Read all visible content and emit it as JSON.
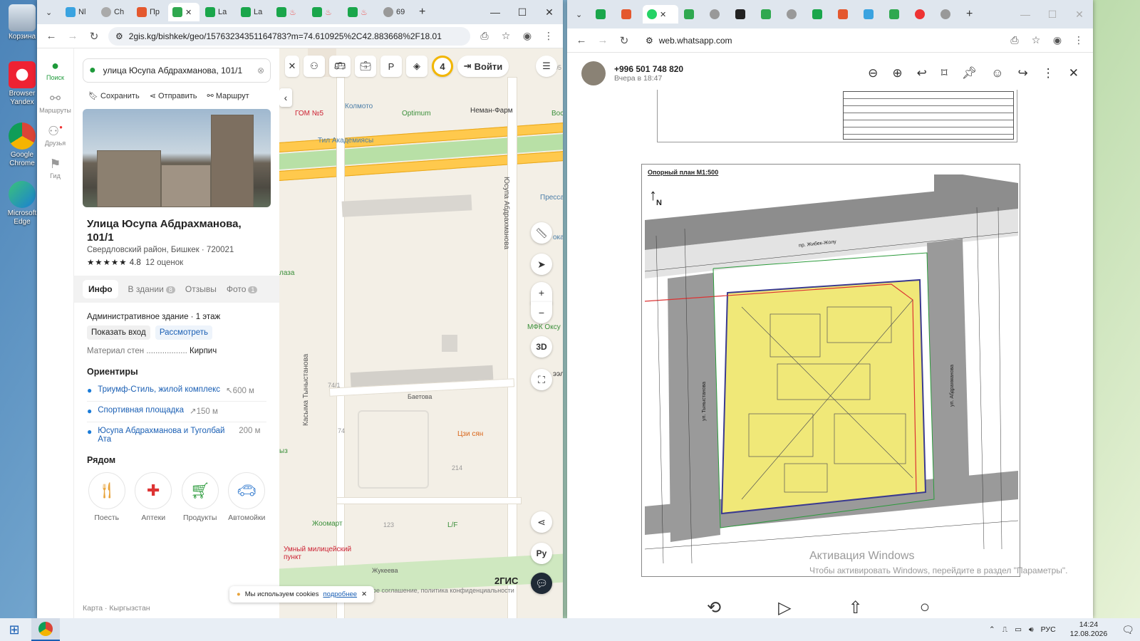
{
  "desktop": {
    "icons": [
      {
        "label": "Корзина"
      },
      {
        "label": "Browser Yandex"
      },
      {
        "label": "Google Chrome"
      },
      {
        "label": "Microsoft Edge"
      }
    ]
  },
  "left_browser": {
    "tabs": [
      "Nl",
      "Ch",
      "Пр",
      "",
      "La",
      "La",
      "",
      "",
      "",
      "69"
    ],
    "url": "2gis.kg/bishkek/geo/15763234351164783?m=74.610925%2C42.883668%2F18.01",
    "rail": [
      "Поиск",
      "Маршруты",
      "Друзья",
      "Гид"
    ],
    "search_value": "улица Юсупа Абдрахманова, 101/1",
    "actions": [
      "Сохранить",
      "Отправить",
      "Маршрут"
    ],
    "place": {
      "name": "Улица Юсупа Абдрахманова, 101/1",
      "district": "Свердловский район, Бишкек · 720021",
      "rating": "4.8",
      "reviews": "12 оценок",
      "stars": "★★★★★"
    },
    "tabs_panel": [
      {
        "label": "Инфо"
      },
      {
        "label": "В здании",
        "count": "8"
      },
      {
        "label": "Отзывы"
      },
      {
        "label": "Фото",
        "count": "1"
      }
    ],
    "info": {
      "type": "Административное здание",
      "floors": "1 этаж",
      "show_entrance": "Показать вход",
      "view": "Рассмотреть",
      "walls_label": "Материал стен",
      "walls_value": "Кирпич"
    },
    "landmarks_title": "Ориентиры",
    "landmarks": [
      {
        "name": "Триумф-Стиль, жилой комплекс",
        "dist": "↖600 м"
      },
      {
        "name": "Спортивная площадка",
        "dist": "↗150 м"
      },
      {
        "name": "Юсупа Абдрахманова и Туголбай Ата",
        "dist": "200 м"
      }
    ],
    "nearby_title": "Рядом",
    "nearby": [
      "Поесть",
      "Аптеки",
      "Продукты",
      "Автомойки"
    ],
    "footer": "Карта · Кыргызстан",
    "map": {
      "badge": "4",
      "login": "Войти",
      "btn_3d": "3D",
      "lang": "Ру",
      "brand": "2ГИС",
      "cookie_text": "Мы используем cookies",
      "cookie_link": "подробнее",
      "labels": [
        "Колмото",
        "Optimum",
        "Неман-Фарм",
        "ГОМ №5",
        "Тил Академиясы",
        "Пресса",
        "Юсупа Абдрахманова",
        "Касыма Тыныстанова",
        "Баетова",
        "74/1",
        "74",
        "214",
        "123",
        "Цзи сян",
        "Жоомарт",
        "L/F",
        "Умный милицейский пункт",
        "Жукеева",
        "МФК Оксу",
        "Boc",
        "лаза",
        "ыз",
        "ока",
        "ээл",
        "05"
      ],
      "legal": "ное соглашение, политика конфиденциальности"
    }
  },
  "right_browser": {
    "url": "web.whatsapp.com",
    "contact": "+996 501 748 820",
    "time": "Вчера в 18:47",
    "plan_title": "Опорный план М1:500",
    "north": "N",
    "street_top": "пр. Жибек-Жолу",
    "street_right": "ул. Абдрахманова",
    "street_left": "ул. Тыныстанова",
    "watermark_title": "Активация Windows",
    "watermark_sub": "Чтобы активировать Windows, перейдите в раздел \"Параметры\"."
  },
  "taskbar": {
    "lang": "РУС",
    "time": "14:24",
    "date": "12.08.2026"
  }
}
